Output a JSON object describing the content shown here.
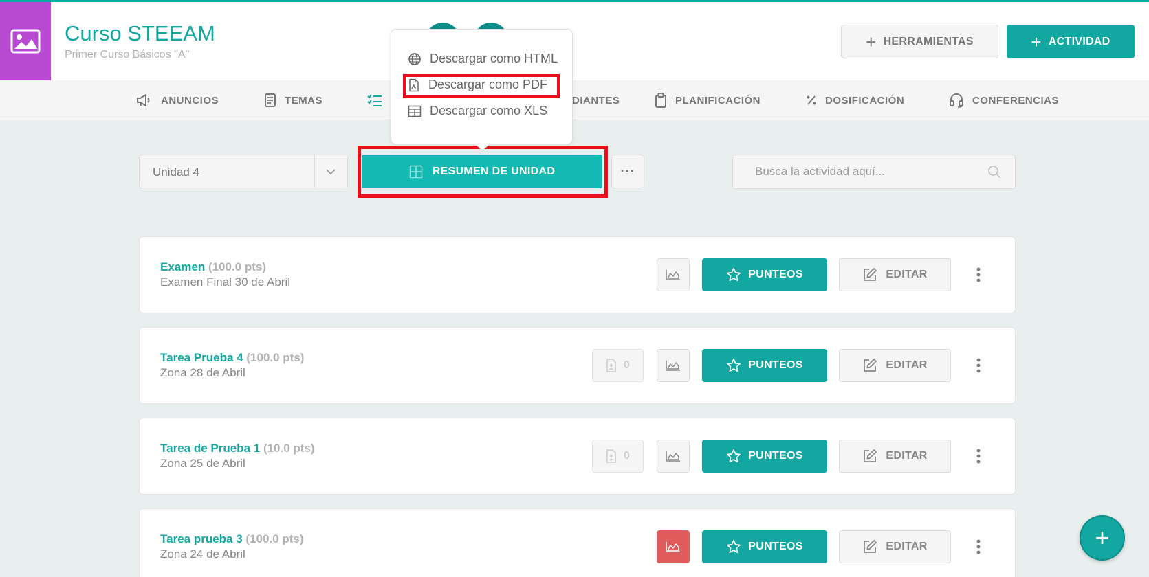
{
  "course": {
    "title": "Curso STEEAM",
    "subtitle": "Primer Curso Básicos \"A\""
  },
  "header_buttons": {
    "tools_label": "HERRAMIENTAS",
    "activity_label": "ACTIVIDAD",
    "plus": "+"
  },
  "nav": {
    "items": [
      {
        "label": "ANUNCIOS",
        "icon": "megaphone-icon"
      },
      {
        "label": "TEMAS",
        "icon": "book-icon"
      },
      {
        "label": "",
        "icon": "checklist-icon"
      },
      {
        "label": "DIANTES",
        "icon": ""
      },
      {
        "label": "PLANIFICACIÓN",
        "icon": "clipboard-icon"
      },
      {
        "label": "DOSIFICACIÓN",
        "icon": "percent-icon"
      },
      {
        "label": "CONFERENCIAS",
        "icon": "headset-icon"
      }
    ]
  },
  "controls": {
    "unit_selected": "Unidad 4",
    "summary_label": "RESUMEN DE UNIDAD",
    "more_label": "···",
    "search_placeholder": "Busca la actividad aquí..."
  },
  "download_menu": {
    "items": [
      {
        "label": "Descargar como HTML",
        "icon": "globe-icon"
      },
      {
        "label": "Descargar como PDF",
        "icon": "pdf-file-icon"
      },
      {
        "label": "Descargar como XLS",
        "icon": "table-icon"
      }
    ]
  },
  "activities": [
    {
      "title": "Examen",
      "points": "(100.0 pts)",
      "subtitle": "Examen Final 30 de Abril",
      "files": null,
      "chart_alert": false
    },
    {
      "title": "Tarea Prueba 4",
      "points": "(100.0 pts)",
      "subtitle": "Zona 28 de Abril",
      "files": "0",
      "chart_alert": false
    },
    {
      "title": "Tarea de Prueba 1",
      "points": "(10.0 pts)",
      "subtitle": "Zona 25 de Abril",
      "files": "0",
      "chart_alert": false
    },
    {
      "title": "Tarea prueba 3",
      "points": "(100.0 pts)",
      "subtitle": "Zona 24 de Abril",
      "files": null,
      "chart_alert": true
    }
  ],
  "card_buttons": {
    "scores_label": "PUNTEOS",
    "edit_label": "EDITAR"
  },
  "fab": {
    "label": "+"
  },
  "colors": {
    "brand_teal": "#13a7a2",
    "summary_teal": "#13b9b3",
    "course_purple": "#b84ad1",
    "highlight_red": "#e8101a",
    "alert_red": "#e05b5b"
  }
}
